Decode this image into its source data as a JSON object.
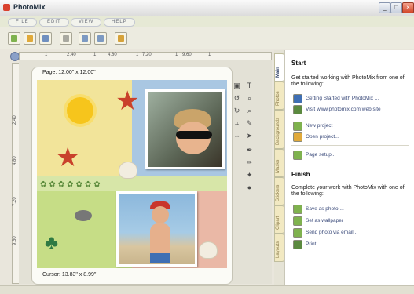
{
  "app": {
    "title": "PhotoMix"
  },
  "window_buttons": {
    "minimize": "_",
    "maximize": "□",
    "close": "×"
  },
  "menu": [
    {
      "label": "FILE"
    },
    {
      "label": "EDIT"
    },
    {
      "label": "VIEW"
    },
    {
      "label": "HELP"
    }
  ],
  "toolbar": {
    "buttons": [
      {
        "icon": "new-page-icon",
        "color": "#7fb24e"
      },
      {
        "icon": "open-icon",
        "color": "#e0a93a"
      },
      {
        "icon": "save-icon",
        "color": "#6f8fbf"
      },
      {
        "icon": "page-icon",
        "color": "#a9a9a0"
      },
      {
        "icon": "undo-icon",
        "color": "#7d9ac2"
      },
      {
        "icon": "redo-icon",
        "color": "#7d9ac2"
      },
      {
        "icon": "help-icon",
        "color": "#d6a23a"
      }
    ]
  },
  "ruler": {
    "h_ticks": [
      "1",
      "2.40",
      "1",
      "4.80",
      "1",
      "7.20",
      "1",
      "9.60",
      "1"
    ],
    "v_ticks": [
      "2.40",
      "4.80",
      "7.20",
      "9.60"
    ]
  },
  "canvas": {
    "page_size": "Page: 12.00\" x 12.00\"",
    "cursor": "Cursor: 13.83\" x 8.99\""
  },
  "tabs": [
    {
      "label": "Main",
      "active": true
    },
    {
      "label": "Photos"
    },
    {
      "label": "Backgrounds"
    },
    {
      "label": "Masks"
    },
    {
      "label": "Stickers"
    },
    {
      "label": "Clipart"
    },
    {
      "label": "Layouts"
    }
  ],
  "panel": {
    "start_heading": "Start",
    "start_text": "Get started working with PhotoMix from one of the following:",
    "start_links": [
      {
        "label": "Getting Started with PhotoMix ...",
        "icon": "help-globe-icon",
        "color": "#3f6fb4"
      },
      {
        "label": "Visit www.photomix.com web site",
        "icon": "home-icon",
        "color": "#5b8a3f"
      }
    ],
    "project_links": [
      {
        "label": "New project",
        "icon": "new-project-icon",
        "color": "#7fb24e"
      },
      {
        "label": "Open project...",
        "icon": "open-project-icon",
        "color": "#e0a93a"
      }
    ],
    "setup_links": [
      {
        "label": "Page setup...",
        "icon": "page-setup-icon",
        "color": "#7fb24e"
      }
    ],
    "finish_heading": "Finish",
    "finish_text": "Complete your work with PhotoMix with one of the following:",
    "finish_links": [
      {
        "label": "Save as photo ...",
        "icon": "save-photo-icon",
        "color": "#7fb24e"
      },
      {
        "label": "Set as wallpaper",
        "icon": "wallpaper-icon",
        "color": "#7fb24e"
      },
      {
        "label": "Send photo via email...",
        "icon": "email-icon",
        "color": "#7fb24e"
      },
      {
        "label": "Print ...",
        "icon": "print-icon",
        "color": "#5b8a3f"
      }
    ]
  }
}
